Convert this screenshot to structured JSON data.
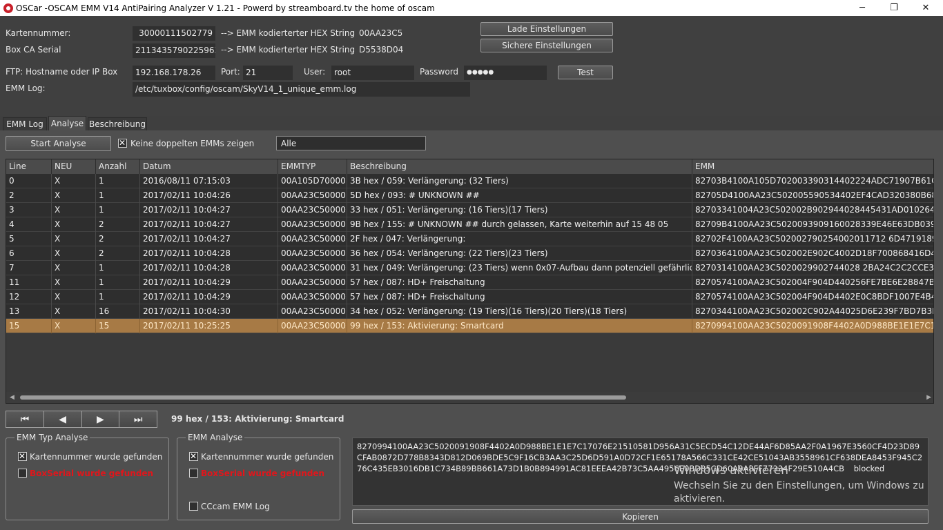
{
  "window": {
    "title": "OSCar -OSCAM EMM V14 AntiPairing Analyzer V 1.21 - Powerd by streamboard.tv the home of oscam",
    "minimize": "─",
    "maximize": "❐",
    "close": "✕"
  },
  "config": {
    "kartennummer_label": "Kartennummer:",
    "kartennummer_value": "30000111502779",
    "kartennummer_arrow": "--> EMM kodierterter HEX String",
    "kartennummer_hex": "00AA23C5",
    "boxca_label": "Box CA Serial",
    "boxca_value": "2113435790225963",
    "boxca_arrow": "--> EMM kodierterter HEX String",
    "boxca_hex": "D5538D04",
    "load_button": "Lade Einstellungen",
    "save_button": "Sichere Einstellungen",
    "ftp_label": "FTP: Hostname oder IP Box",
    "ftp_value": "192.168.178.26",
    "port_label": "Port:",
    "port_value": "21",
    "user_label": "User:",
    "user_value": "root",
    "password_label": "Password",
    "password_value": "●●●●●",
    "test_button": "Test",
    "emmlog_label": "EMM Log:",
    "emmlog_value": "/etc/tuxbox/config/oscam/SkyV14_1_unique_emm.log"
  },
  "tabs": [
    {
      "label": "EMM Log"
    },
    {
      "label": "Analyse"
    },
    {
      "label": "Beschreibung"
    }
  ],
  "analyse": {
    "start_button": "Start Analyse",
    "no_duplicates_label": "Keine doppelten EMMs zeigen",
    "filter_selected": "Alle"
  },
  "table": {
    "columns": [
      "Line",
      "NEU",
      "Anzahl",
      "Datum",
      "EMMTYP",
      "Beschreibung",
      "EMM"
    ],
    "rows": [
      {
        "line": "0",
        "neu": "X",
        "anzahl": "1",
        "datum": "2016/08/11 07:15:03",
        "emmtyp": "00A105D70000...",
        "beschreibung": "3B hex / 059: Verlängerung: (32 Tiers)",
        "emm": "82703B4100A105D702003390314402224ADC71907B61CADE4A96"
      },
      {
        "line": "2",
        "neu": "X",
        "anzahl": "1",
        "datum": "2017/02/11 10:04:26",
        "emmtyp": "00AA23C50000...",
        "beschreibung": "5D hex / 093: # UNKNOWN ##",
        "emm": "82705D4100AA23C502005590534402EF4CAD320380B68241A6B4"
      },
      {
        "line": "3",
        "neu": "X",
        "anzahl": "1",
        "datum": "2017/02/11 10:04:27",
        "emmtyp": "00AA23C50000...",
        "beschreibung": "33 hex / 051: Verlängerung: (16 Tiers)(17 Tiers)",
        "emm": "82703341004A23C502002B902944028445431AD010264681D769"
      },
      {
        "line": "4",
        "neu": "X",
        "anzahl": "2",
        "datum": "2017/02/11 10:04:27",
        "emmtyp": "00AA23C50000...",
        "beschreibung": "9B hex / 155: # UNKNOWN ## durch gelassen, Karte weiterhin auf 15 48 05",
        "emm": "82709B4100AA23C5020093909160028339E46E63DB039FF7C88A1"
      },
      {
        "line": "5",
        "neu": "X",
        "anzahl": "2",
        "datum": "2017/02/11 10:04:27",
        "emmtyp": "00AA23C50000...",
        "beschreibung": "2F hex / 047: Verlängerung:",
        "emm": "82702F4100AA23C502002790254002011712 6D4719189EC98B87E"
      },
      {
        "line": "6",
        "neu": "X",
        "anzahl": "2",
        "datum": "2017/02/11 10:04:28",
        "emmtyp": "00AA23C50000...",
        "beschreibung": "36 hex / 054: Verlängerung: (22 Tiers)(23 Tiers)",
        "emm": "8270364100AA23C502002E902C4002D18F700868416D4FD688C5"
      },
      {
        "line": "7",
        "neu": "X",
        "anzahl": "1",
        "datum": "2017/02/11 10:04:28",
        "emmtyp": "00AA23C50000...",
        "beschreibung": "31 hex / 049: Verlängerung: (23 Tiers) wenn 0x07-Aufbau dann potenziell gefährlich!",
        "emm": "8270314100AA23C5020029902744028 2BA24C2C2CCE35B90FEDC"
      },
      {
        "line": "11",
        "neu": "X",
        "anzahl": "1",
        "datum": "2017/02/11 10:04:29",
        "emmtyp": "00AA23C50000...",
        "beschreibung": "57 hex / 087: HD+ Freischaltung",
        "emm": "8270574100AA23C502004F904D440256FE7BE6E28847B6718C74B"
      },
      {
        "line": "12",
        "neu": "X",
        "anzahl": "1",
        "datum": "2017/02/11 10:04:29",
        "emmtyp": "00AA23C50000...",
        "beschreibung": "57 hex / 087: HD+ Freischaltung",
        "emm": "8270574100AA23C502004F904D4402E0C8BDF1007E4B49405F962"
      },
      {
        "line": "13",
        "neu": "X",
        "anzahl": "16",
        "datum": "2017/02/11 10:04:30",
        "emmtyp": "00AA23C50000...",
        "beschreibung": "34 hex / 052: Verlängerung: (19 Tiers)(16 Tiers)(20 Tiers)(18 Tiers)",
        "emm": "8270344100AA23C502002C902A44025D6E239F7BD7B3F8702B440"
      },
      {
        "line": "15",
        "neu": "X",
        "anzahl": "15",
        "datum": "2017/02/11 10:25:25",
        "emmtyp": "00AA23C50000...",
        "beschreibung": "99 hex / 153: Aktivierung: Smartcard",
        "emm": "8270994100AA23C5020091908F4402A0D988BE1E1E7C17076E215"
      }
    ]
  },
  "navigation": {
    "first": "⏮",
    "prev": "◀",
    "next": "▶",
    "last": "⏭",
    "current_description": "99 hex / 153: Aktivierung: Smartcard"
  },
  "emm_typ_analyse": {
    "title": "EMM Typ Analyse",
    "kartennummer_found": "Kartennummer wurde gefunden",
    "boxserial_found": "BoxSerial wurde gefunden"
  },
  "emm_analyse": {
    "title": "EMM Analyse",
    "kartennummer_found": "Kartennummer wurde gefunden",
    "boxserial_found": "BoxSerial wurde gefunden",
    "cccam_label": "CCcam EMM Log"
  },
  "hex_output": {
    "text": "8270994100AA23C5020091908F4402A0D988BE1E1E7C17076E21510581D956A31C5ECD54C12DE44AF6D85AA2F0A1967E3560CF4D23D89CFAB0872D778B8343D812D069BDE5C9F16CB3AA3C25D6D591A0D72CF1E65178A566C331CE42CE51043AB3558961CF638DEA8453F945C276C435EB3016DB1C734B89BB661A73D1B0B894991AC81EEEA42B73C5AA4956E0BD85CD60A8A8FF77334F29E510A4CB",
    "trailing_word": "blocked",
    "copy_button": "Kopieren"
  },
  "watermark": {
    "title": "Windows aktivieren",
    "line1": "Wechseln Sie zu den Einstellungen, um Windows zu",
    "line2": "aktivieren."
  }
}
